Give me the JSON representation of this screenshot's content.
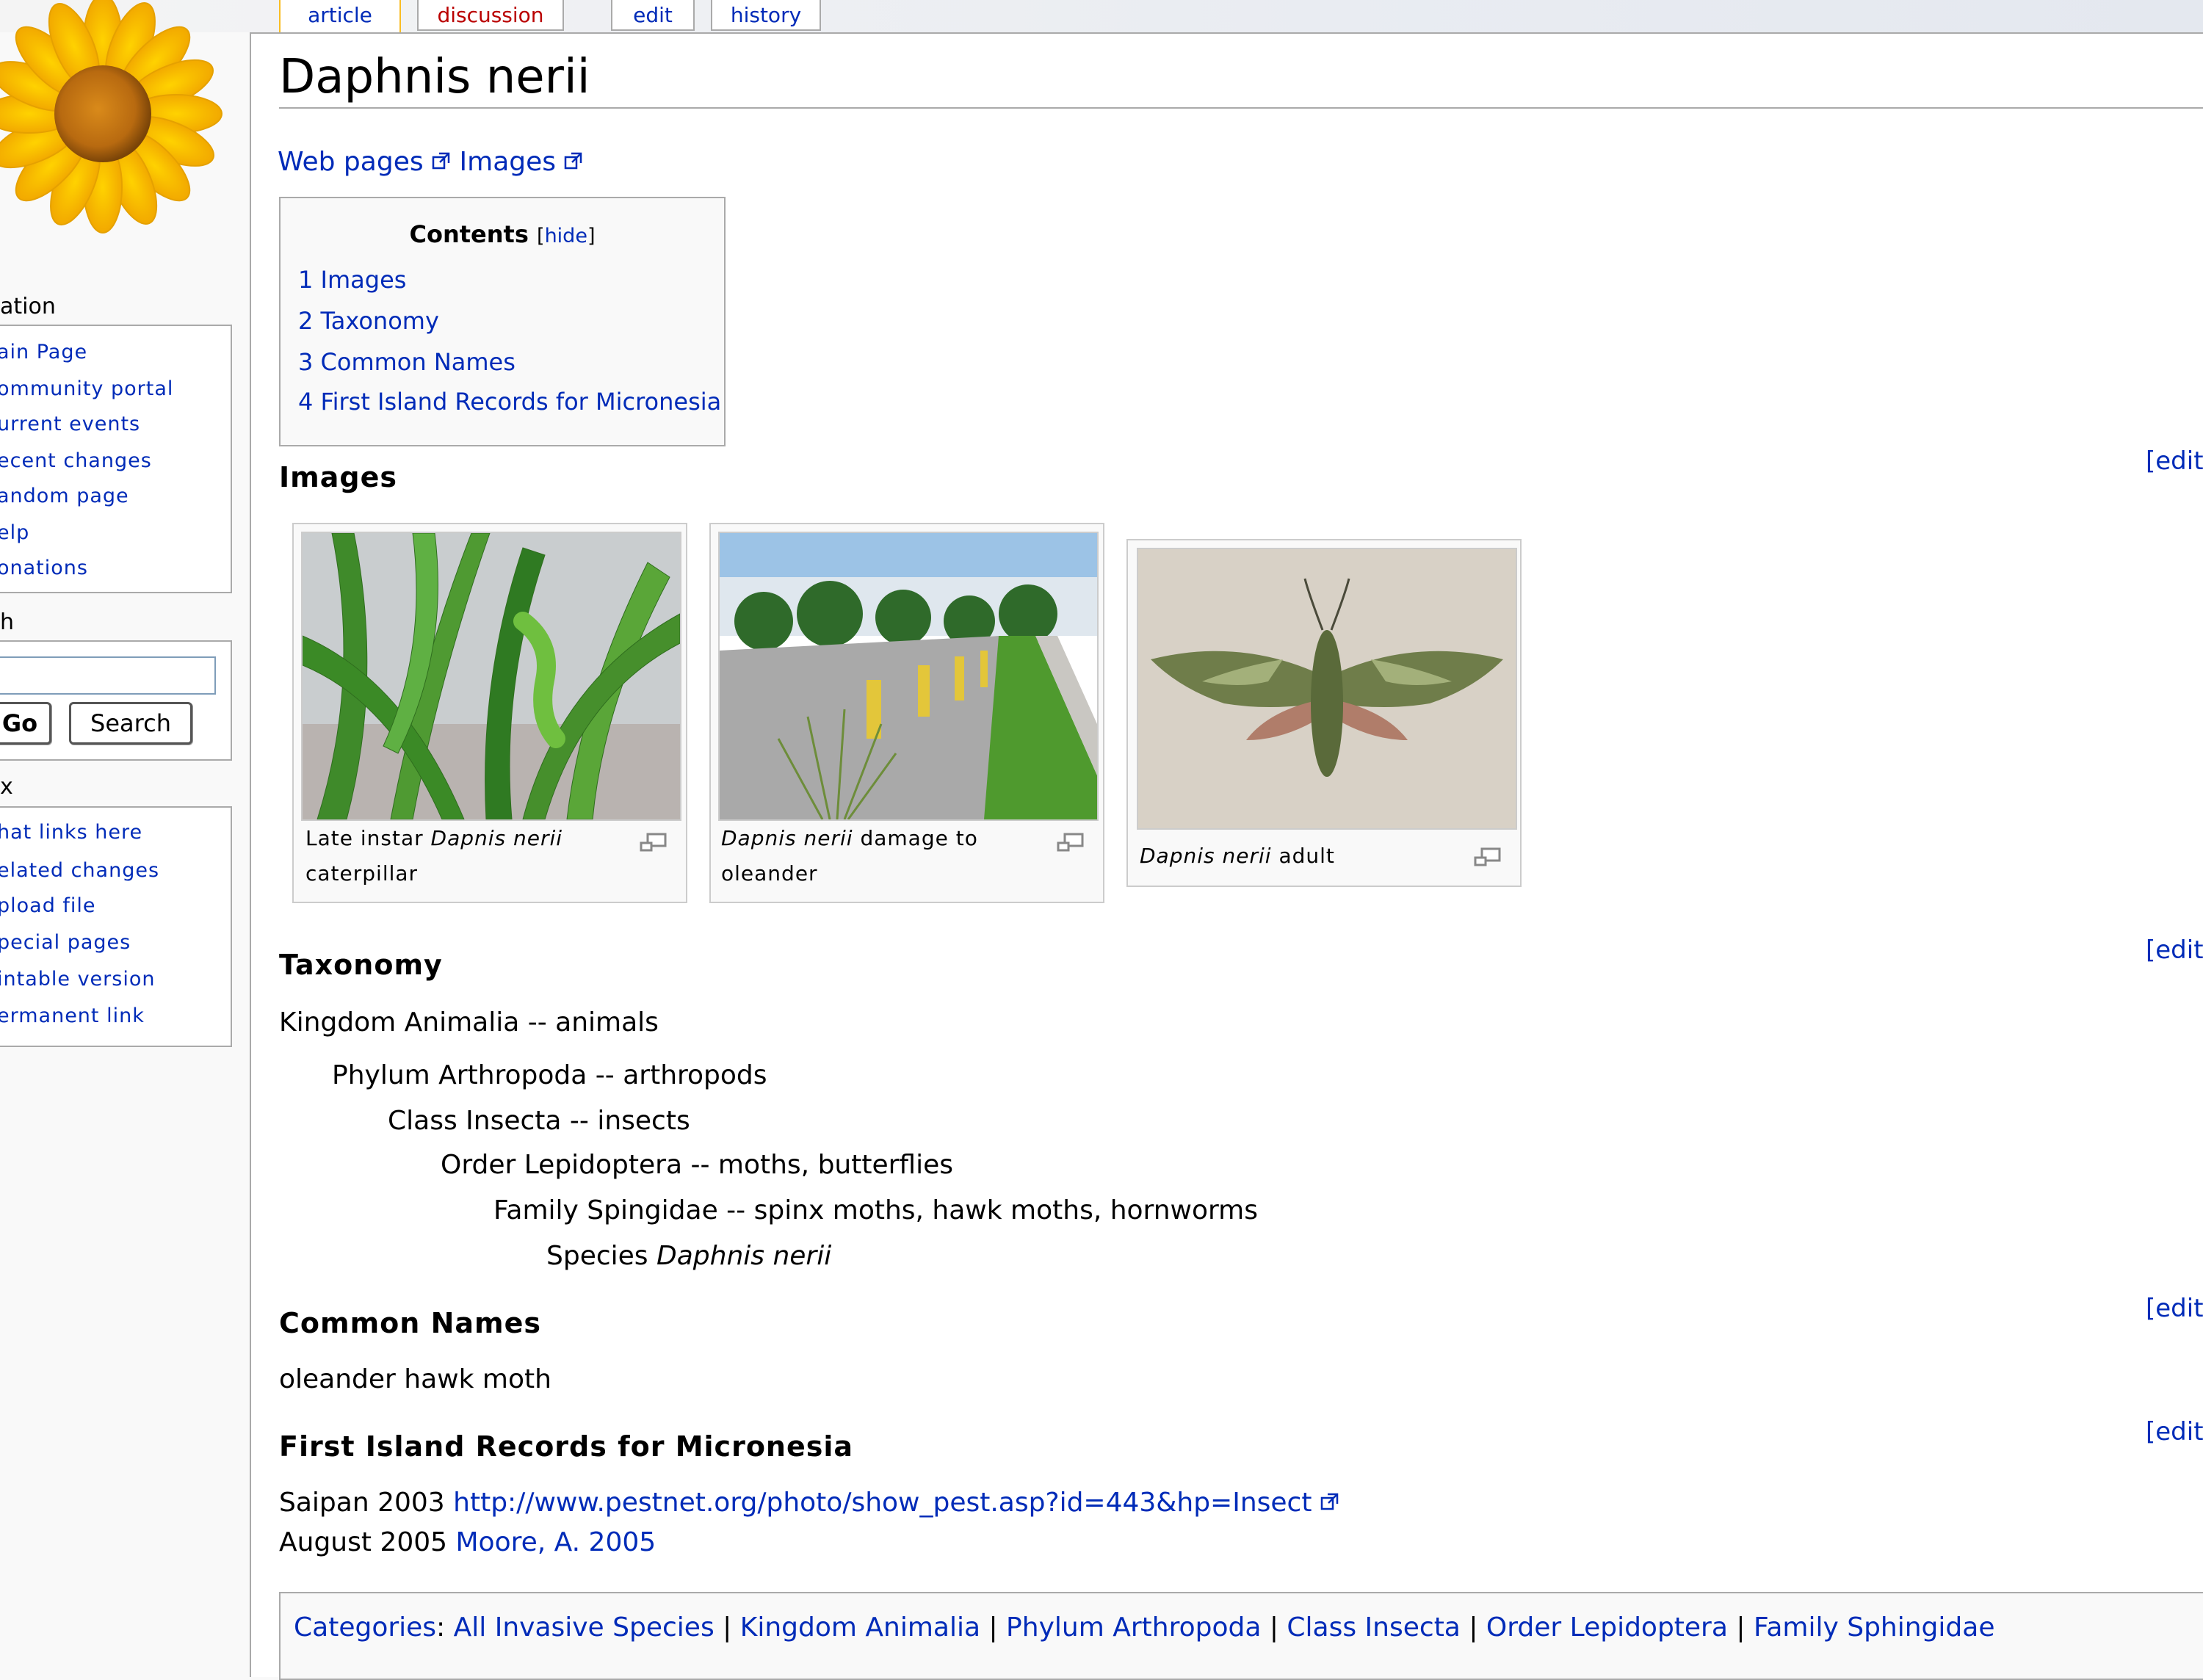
{
  "tabs": [
    {
      "label": "article",
      "state": "selected"
    },
    {
      "label": "discussion",
      "state": "new"
    },
    {
      "label": "edit",
      "state": "normal"
    },
    {
      "label": "history",
      "state": "normal"
    }
  ],
  "sidebar": {
    "navigation": {
      "heading": "ation",
      "items": [
        "ain Page",
        "ommunity portal",
        "urrent events",
        "ecent changes",
        "andom page",
        "elp",
        "onations"
      ]
    },
    "search": {
      "heading": "h",
      "input_value": "",
      "go_label": "Go",
      "search_label": "Search"
    },
    "toolbox": {
      "heading": "x",
      "items": [
        "hat links here",
        "elated changes",
        "pload file",
        "pecial pages",
        "intable version",
        "ermanent link"
      ]
    }
  },
  "page": {
    "title": "Daphnis nerii",
    "external_links": [
      "Web pages",
      "Images"
    ],
    "toc": {
      "title": "Contents",
      "hide_label": "hide",
      "items": [
        "1 Images",
        "2 Taxonomy",
        "3 Common Names",
        "4 First Island Records for Micronesia"
      ]
    },
    "edit_label": "[edit]",
    "sections": {
      "images": {
        "heading": "Images",
        "thumbs": [
          {
            "caption_lines": [
              [
                "Late instar ",
                "Dapnis nerii",
                ""
              ],
              [
                "caterpillar"
              ]
            ]
          },
          {
            "caption_lines": [
              [
                "",
                "Dapnis nerii",
                " damage to"
              ],
              [
                "oleander"
              ]
            ]
          },
          {
            "caption_lines": [
              [
                "",
                "Dapnis nerii",
                " adult"
              ]
            ]
          }
        ]
      },
      "taxonomy": {
        "heading": "Taxonomy",
        "lines": [
          "Kingdom Animalia -- animals",
          "Phylum Arthropoda -- arthropods",
          "Class Insecta -- insects",
          "Order Lepidoptera -- moths, butterflies",
          "Family Spingidae -- spinx moths, hawk moths, hornworms"
        ],
        "species_prefix": "Species ",
        "species_name": "Daphnis nerii"
      },
      "common_names": {
        "heading": "Common Names",
        "text": "oleander hawk moth"
      },
      "first_records": {
        "heading": "First Island Records for Micronesia",
        "line1_prefix": "Saipan 2003 ",
        "line1_link": "http://www.pestnet.org/photo/show_pest.asp?id=443&hp=Insect",
        "line2_prefix": "August 2005 ",
        "line2_link": "Moore, A. 2005"
      }
    },
    "categories": {
      "label": "Categories",
      "items": [
        "All Invasive Species",
        "Kingdom Animalia",
        "Phylum Arthropoda",
        "Class Insecta",
        "Order Lepidoptera",
        "Family Sphingidae"
      ]
    }
  },
  "colors": {
    "link": "#002bb8",
    "new_link": "#ba0000",
    "selected_tab_border": "#fabd23",
    "border": "#aaaaaa"
  }
}
